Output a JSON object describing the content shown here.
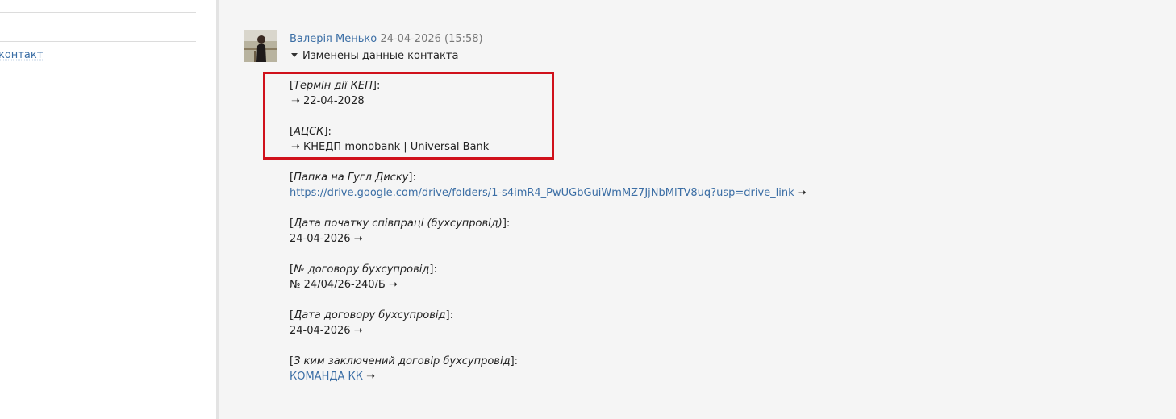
{
  "sidebar": {
    "contact_link": "контакт"
  },
  "entry": {
    "author": "Валерія Менько",
    "datetime": "24-04-2026 (15:58)",
    "summary": "Изменены данные контакта",
    "fields": [
      {
        "label": "Термін дії КЕП",
        "value": "22-04-2028",
        "arrow_before": true
      },
      {
        "label": "АЦСК",
        "value": "КНЕДП monobank | Universal Bank",
        "arrow_before": true
      },
      {
        "label": "Папка на Гугл Диску",
        "value": "https://drive.google.com/drive/folders/1-s4imR4_PwUGbGuiWmMZ7JjNbMlTV8uq?usp=drive_link",
        "link": true
      },
      {
        "label": "Дата початку співпраці (бухсупровід)",
        "value": "24-04-2026"
      },
      {
        "label": "№ договору бухсупровід",
        "value": "№ 24/04/26-240/Б"
      },
      {
        "label": "Дата договору бухсупровід",
        "value": "24-04-2026"
      },
      {
        "label": "З ким заключений договір бухсупровід",
        "value": "КОМАНДА КК",
        "link": true
      }
    ],
    "arrow_glyph": "➝"
  },
  "colors": {
    "link": "#3b6ea5",
    "highlight_border": "#d0111b",
    "main_background": "#f5f5f5"
  }
}
